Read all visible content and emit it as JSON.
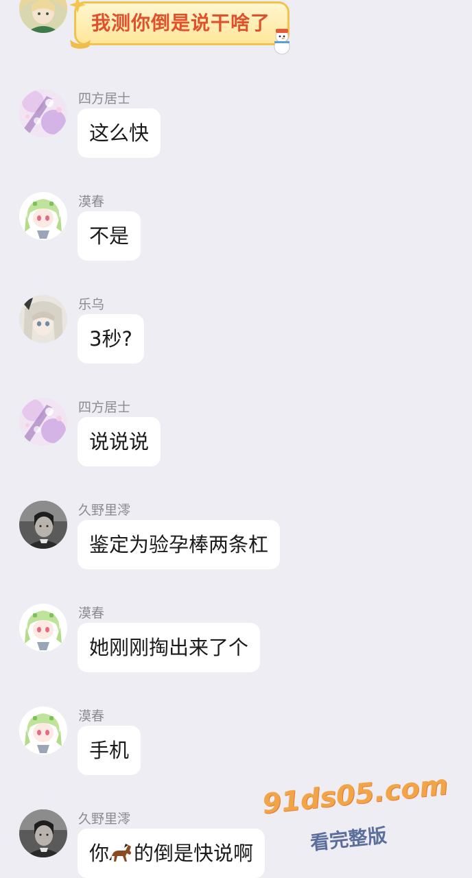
{
  "messages": [
    {
      "sender": "",
      "text": "我测你倒是说干啥了",
      "avatar": "anime-blonde-green-avatar",
      "style": "fancy"
    },
    {
      "sender": "四方居士",
      "text": "这么快",
      "avatar": "purple-sakura-avatar"
    },
    {
      "sender": "漠春",
      "text": "不是",
      "avatar": "green-hair-chibi-avatar"
    },
    {
      "sender": "乐乌",
      "text": "3秒?",
      "avatar": "silver-hair-anime-avatar"
    },
    {
      "sender": "四方居士",
      "text": "说说说",
      "avatar": "purple-sakura-avatar"
    },
    {
      "sender": "久野里澪",
      "text": "鉴定为验孕棒两条杠",
      "avatar": "bw-portrait-avatar"
    },
    {
      "sender": "漠春",
      "text": "她刚刚掏出来了个",
      "avatar": "green-hair-chibi-avatar"
    },
    {
      "sender": "漠春",
      "text": "手机",
      "avatar": "green-hair-chibi-avatar"
    },
    {
      "sender": "久野里澪",
      "text_before": "你",
      "emoji": "horse-emoji",
      "text_after": "的倒是快说啊",
      "avatar": "bw-portrait-avatar"
    }
  ],
  "watermark": {
    "site": "91ds05.com",
    "caption": "看完整版"
  },
  "colors": {
    "background": "#eeedf3",
    "bubble": "#ffffff",
    "sender_name": "#8a8a90",
    "fancy_text": "#e0502a",
    "watermark_main": "#f2a547",
    "watermark_sub": "#5c6e9c"
  }
}
